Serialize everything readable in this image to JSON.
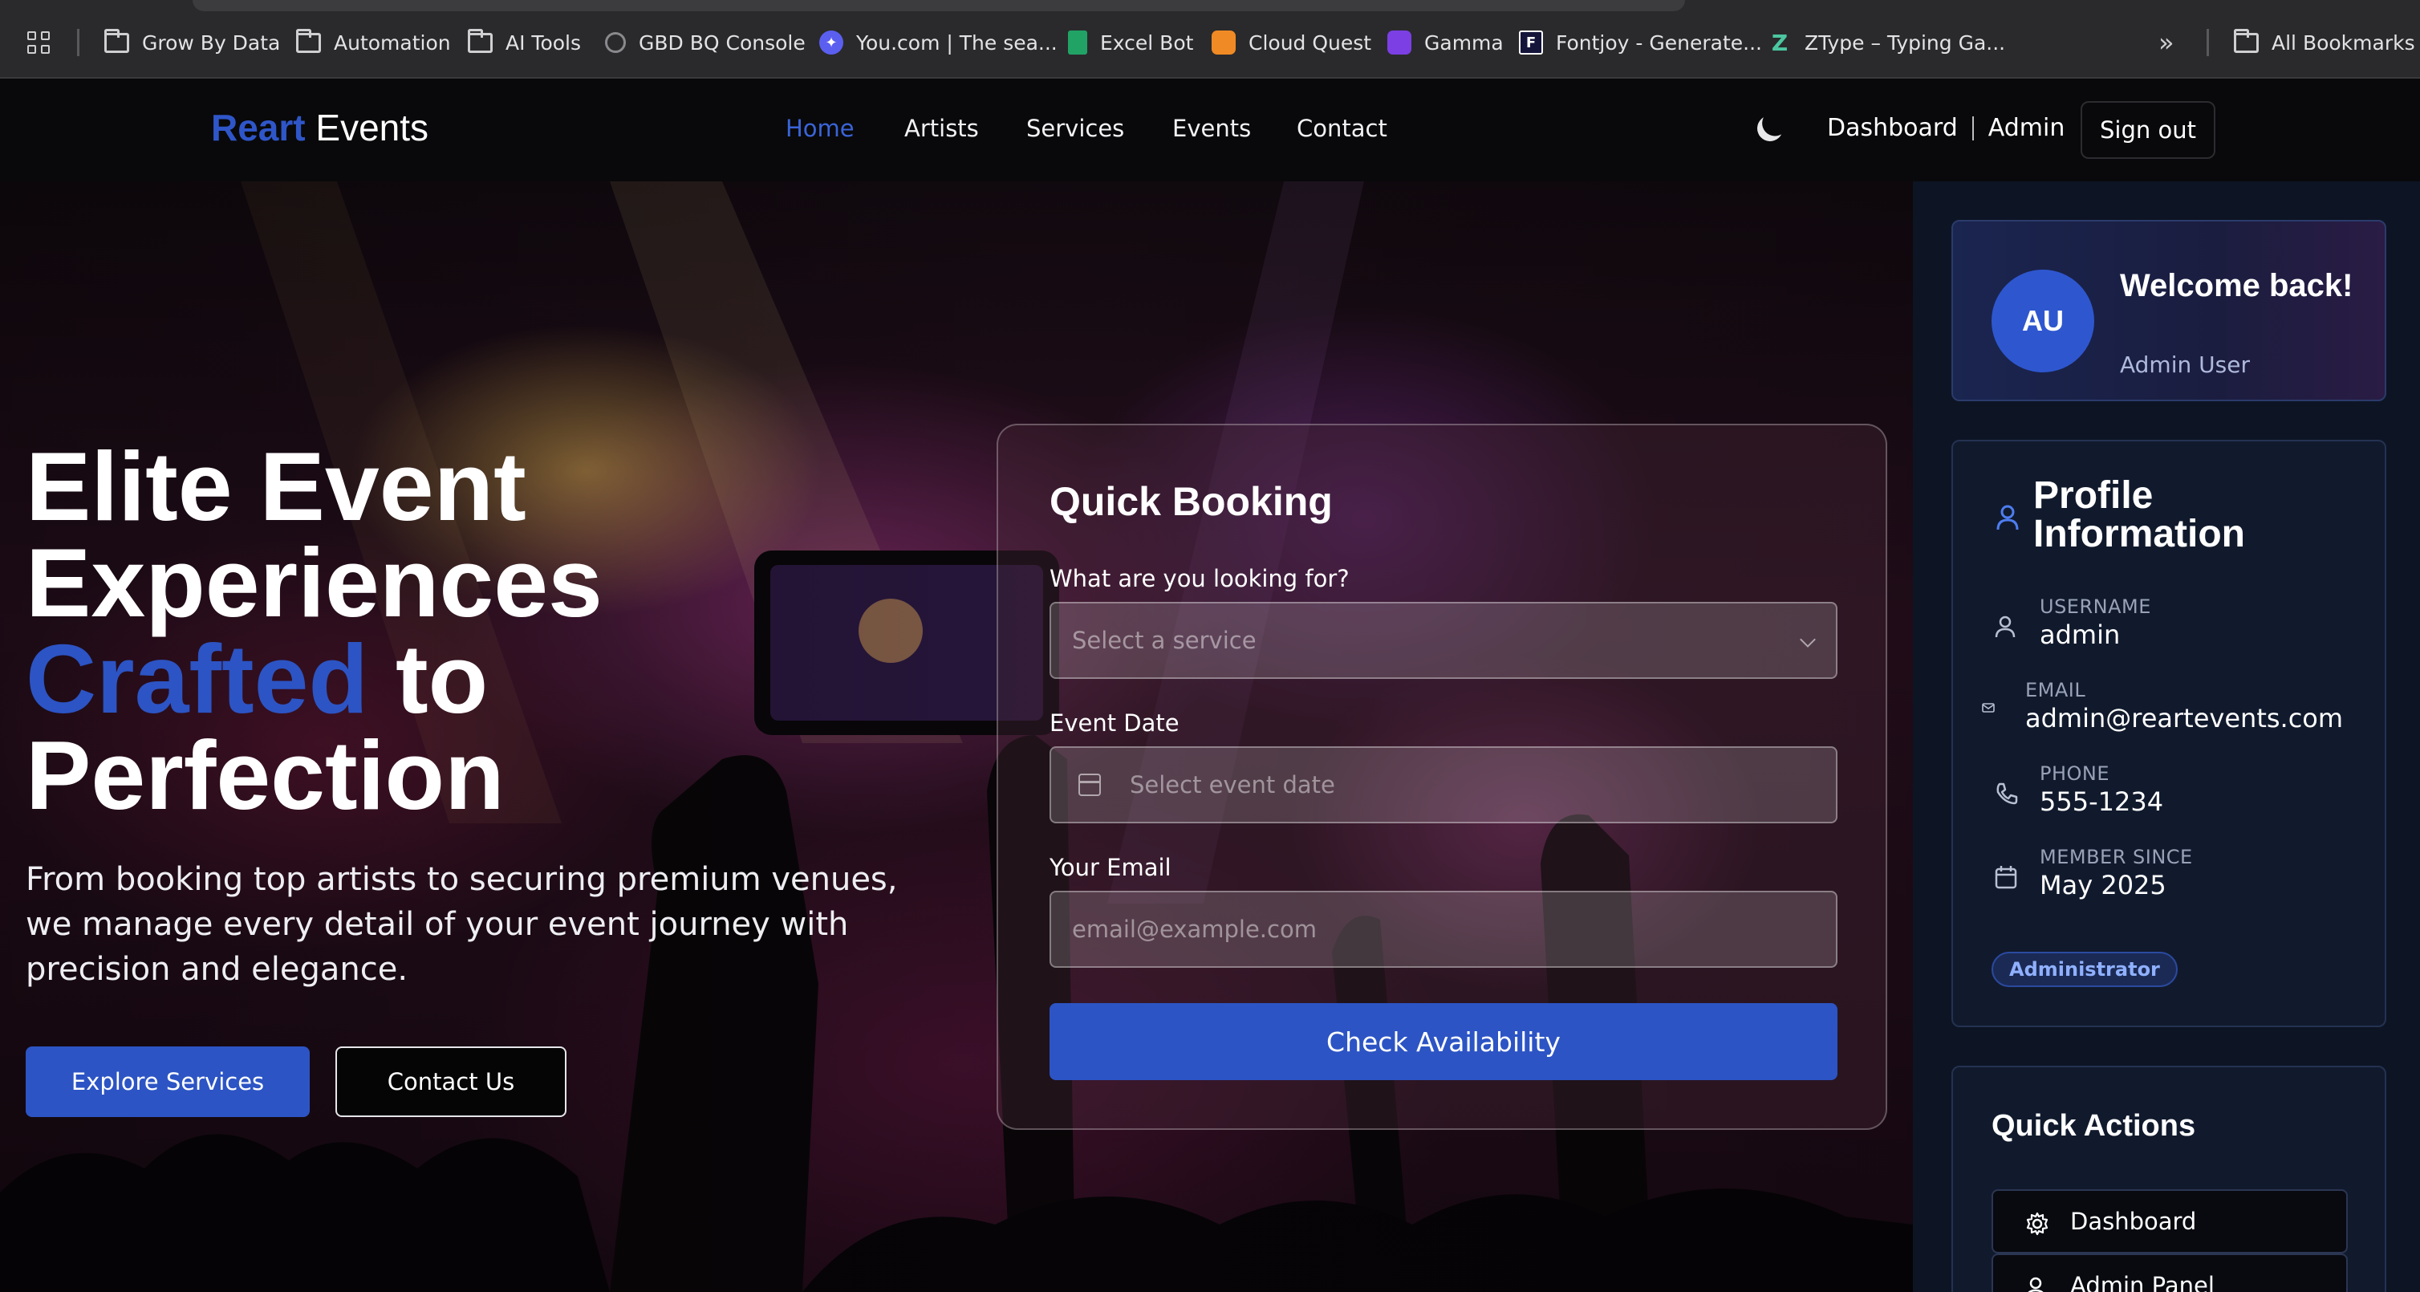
{
  "bookmarks": [
    {
      "label": "Grow By Data",
      "icon": "folder-icon"
    },
    {
      "label": "Automation",
      "icon": "folder-icon"
    },
    {
      "label": "AI Tools",
      "icon": "folder-icon"
    },
    {
      "label": "GBD BQ Console",
      "icon": "bigquery-icon"
    },
    {
      "label": "You.com | The sea...",
      "icon": "youcom-icon"
    },
    {
      "label": "Excel Bot",
      "icon": "sheet-icon"
    },
    {
      "label": "Cloud Quest",
      "icon": "cube-icon"
    },
    {
      "label": "Gamma",
      "icon": "gamma-icon"
    },
    {
      "label": "Fontjoy - Generate...",
      "icon": "fontjoy-icon"
    },
    {
      "label": "ZType – Typing Ga...",
      "icon": "ztype-icon"
    }
  ],
  "bookmarks_overflow": "»",
  "all_bookmarks": "All Bookmarks",
  "nav": {
    "brand_first": "Reart",
    "brand_second": "Events",
    "links": [
      "Home",
      "Artists",
      "Services",
      "Events",
      "Contact"
    ],
    "dashboard": "Dashboard",
    "admin": "Admin",
    "sign_out": "Sign out"
  },
  "hero": {
    "title_line1": "Elite Event",
    "title_line2": "Experiences",
    "title_accent": "Crafted",
    "title_line3_rest": " to",
    "title_line4": "Perfection",
    "subtitle": "From booking top artists to securing premium venues, we manage every detail of your event journey with precision and elegance.",
    "cta_primary": "Explore Services",
    "cta_secondary": "Contact Us"
  },
  "booking": {
    "title": "Quick Booking",
    "service_label": "What are you looking for?",
    "service_placeholder": "Select a service",
    "date_label": "Event Date",
    "date_placeholder": "Select event date",
    "email_label": "Your Email",
    "email_placeholder": "email@example.com",
    "submit": "Check Availability"
  },
  "welcome": {
    "initials": "AU",
    "title": "Welcome back!",
    "name": "Admin User"
  },
  "profile": {
    "title": "Profile Information",
    "username_label": "USERNAME",
    "username": "admin",
    "email_label": "EMAIL",
    "email": "admin@reartevents.com",
    "phone_label": "PHONE",
    "phone": "555-1234",
    "member_label": "MEMBER SINCE",
    "member_since": "May 2025",
    "role": "Administrator"
  },
  "quick_actions": {
    "title": "Quick Actions",
    "items": [
      "Dashboard",
      "Admin Panel"
    ]
  },
  "colors": {
    "accent": "#2c54c4",
    "nav_active": "#3a64d8",
    "sidebar_bg": "#0d1424"
  }
}
